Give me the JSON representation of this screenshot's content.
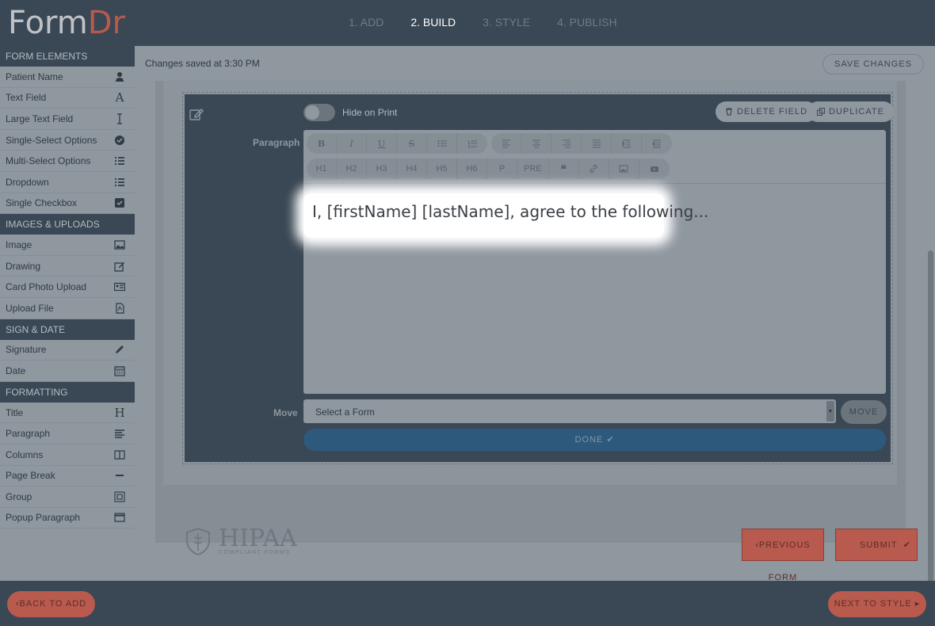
{
  "app": {
    "logo_part1": "Form",
    "logo_part2": "Dr"
  },
  "steps": [
    {
      "label": "1. ADD",
      "active": false
    },
    {
      "label": "2. BUILD",
      "active": true
    },
    {
      "label": "3. STYLE",
      "active": false
    },
    {
      "label": "4. PUBLISH",
      "active": false
    }
  ],
  "sidebar": {
    "sections": [
      {
        "title": "FORM ELEMENTS",
        "items": [
          {
            "label": "Patient Name",
            "icon": "user-icon"
          },
          {
            "label": "Text Field",
            "icon": "font-a-icon"
          },
          {
            "label": "Large Text Field",
            "icon": "text-cursor-icon"
          },
          {
            "label": "Single-Select Options",
            "icon": "check-circle-icon"
          },
          {
            "label": "Multi-Select Options",
            "icon": "list-icon"
          },
          {
            "label": "Dropdown",
            "icon": "list-dropdown-icon"
          },
          {
            "label": "Single Checkbox",
            "icon": "checkbox-icon"
          }
        ]
      },
      {
        "title": "IMAGES & UPLOADS",
        "items": [
          {
            "label": "Image",
            "icon": "image-icon"
          },
          {
            "label": "Drawing",
            "icon": "edit-square-icon"
          },
          {
            "label": "Card Photo Upload",
            "icon": "id-card-icon"
          },
          {
            "label": "Upload File",
            "icon": "pdf-file-icon"
          }
        ]
      },
      {
        "title": "SIGN & DATE",
        "items": [
          {
            "label": "Signature",
            "icon": "pencil-icon"
          },
          {
            "label": "Date",
            "icon": "calendar-icon"
          }
        ]
      },
      {
        "title": "FORMATTING",
        "items": [
          {
            "label": "Title",
            "icon": "heading-h-icon"
          },
          {
            "label": "Paragraph",
            "icon": "align-left-icon"
          },
          {
            "label": "Columns",
            "icon": "columns-icon"
          },
          {
            "label": "Page Break",
            "icon": "minus-icon"
          },
          {
            "label": "Group",
            "icon": "group-icon"
          },
          {
            "label": "Popup Paragraph",
            "icon": "window-icon"
          }
        ]
      }
    ]
  },
  "status": {
    "saved_text": "Changes saved at 3:30 PM",
    "save_button": "SAVE CHANGES"
  },
  "editor": {
    "hide_on_print_label": "Hide on Print",
    "hide_on_print_on": false,
    "delete_button": "DELETE FIELD",
    "duplicate_button": "DUPLICATE",
    "paragraph_label": "Paragraph",
    "toolbar_row1": [
      [
        "bold",
        "italic",
        "underline",
        "strikethrough",
        "bullet-list",
        "numbered-list"
      ],
      [
        "align-left",
        "align-center",
        "align-right",
        "align-justify",
        "indent",
        "outdent"
      ]
    ],
    "toolbar_row2": [
      "H1",
      "H2",
      "H3",
      "H4",
      "H5",
      "H6",
      "P",
      "PRE"
    ],
    "content": "I, [firstName] [lastName], agree to the following...",
    "move_label": "Move",
    "select_value": "Select a Form",
    "move_button": "MOVE",
    "done_button": "DONE"
  },
  "footer_logo": {
    "line1": "HIPAA",
    "line2": "COMPLIANT FORMS"
  },
  "nav": {
    "previous_form": "PREVIOUS FORM",
    "submit": "SUBMIT",
    "back_to_add": "BACK TO ADD",
    "next_to_style": "NEXT TO STYLE"
  },
  "colors": {
    "dark": "#3a4754",
    "overlay_gray": "#8f979f",
    "accent_red": "#b85a4e",
    "done_blue": "#2d5a7c"
  }
}
